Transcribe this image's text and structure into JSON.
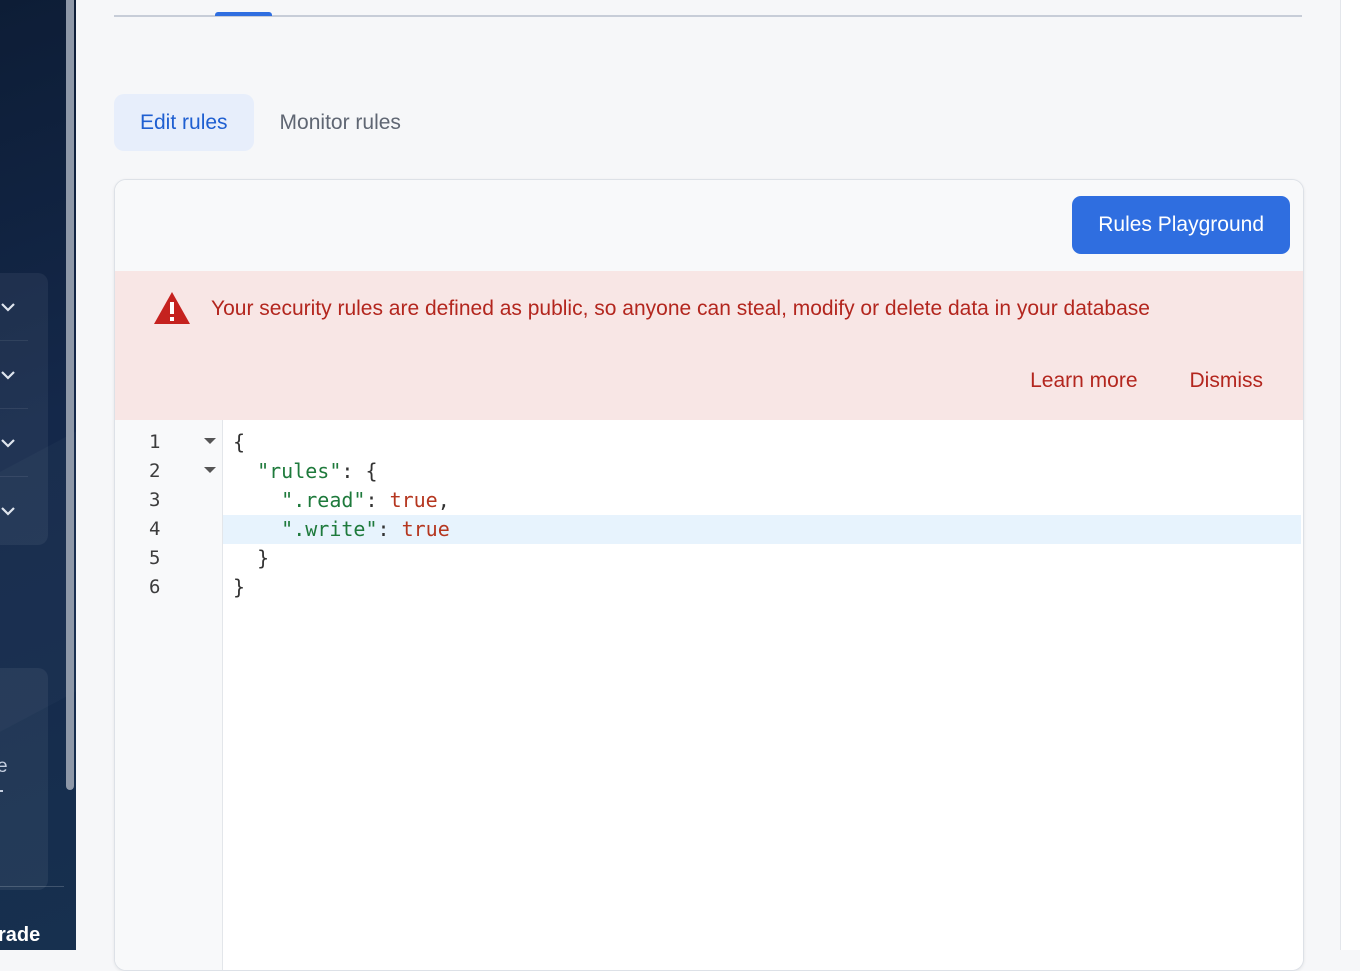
{
  "sidebar": {
    "promo_fragment": "e",
    "upgrade_fragment": "rade"
  },
  "tabs": {
    "edit_rules": "Edit rules",
    "monitor_rules": "Monitor rules"
  },
  "toolbar": {
    "rules_playground": "Rules Playground"
  },
  "banner": {
    "message": "Your security rules are defined as public, so anyone can steal, modify or delete data in your database",
    "learn_more": "Learn more",
    "dismiss": "Dismiss",
    "icon": "warning-icon",
    "color": "#b3261e"
  },
  "editor": {
    "line_numbers": [
      "1",
      "2",
      "3",
      "4",
      "5",
      "6"
    ],
    "active_line": 4,
    "lines": {
      "l1": {
        "brace": "{"
      },
      "l2": {
        "indent": "  ",
        "key": "\"rules\"",
        "rest": ": {"
      },
      "l3": {
        "indent": "    ",
        "key": "\".read\"",
        "colon": ": ",
        "value": "true",
        "rest": ","
      },
      "l4": {
        "indent": "    ",
        "key": "\".write\"",
        "colon": ": ",
        "value": "true"
      },
      "l5": {
        "indent": "  ",
        "brace": "}"
      },
      "l6": {
        "brace": "}"
      }
    }
  },
  "colors": {
    "accent": "#2f6ee0",
    "danger": "#b3261e",
    "json_key": "#1e7a3c",
    "json_literal": "#b5361f"
  }
}
